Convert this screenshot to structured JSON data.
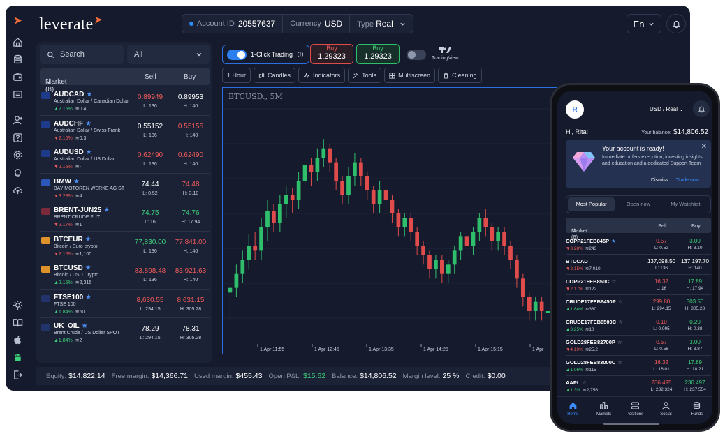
{
  "header": {
    "brand": "leverate",
    "account_id_label": "Account ID",
    "account_id": "20557637",
    "currency_label": "Currency",
    "currency": "USD",
    "type_label": "Type",
    "type": "Real",
    "language": "En"
  },
  "market_panel": {
    "search_label": "Search",
    "filter_value": "All",
    "col_market": "Market (8)",
    "col_sell": "Sell",
    "col_buy": "Buy",
    "rows": [
      {
        "symbol": "AUDCAD",
        "desc": "Australian Dollar / Canadian Dollar",
        "change": "▲2.15%",
        "vol": "≋0.4",
        "sell": "0.89949",
        "buy": "0.89953",
        "low": "L: 136",
        "high": "H: 140",
        "sell_color": "#f05a5a",
        "buy_color": "#ffffff",
        "chg_color": "#3ecf7a"
      },
      {
        "symbol": "AUDCHF",
        "desc": "Australian Dollar / Swiss Frank",
        "change": "▼2.15%",
        "vol": "≋0.3",
        "sell": "0.55152",
        "buy": "0.55155",
        "low": "L: 136",
        "high": "H: 140",
        "sell_color": "#ffffff",
        "buy_color": "#f05a5a",
        "chg_color": "#f05a5a"
      },
      {
        "symbol": "AUDUSD",
        "desc": "Australian Dollar / US Dollar",
        "change": "▼2.15%",
        "vol": "≋-",
        "sell": "0.62490",
        "buy": "0.62490",
        "low": "L: 136",
        "high": "H: 140",
        "sell_color": "#f05a5a",
        "buy_color": "#f05a5a",
        "chg_color": "#f05a5a"
      },
      {
        "symbol": "BMW",
        "desc": "BAY MOTOREN WERKE AG ST",
        "change": "▼3.28%",
        "vol": "≋4",
        "sell": "74.44",
        "buy": "74.48",
        "low": "L: 0.52",
        "high": "H: 3.10",
        "sell_color": "#ffffff",
        "buy_color": "#f05a5a",
        "chg_color": "#f05a5a"
      },
      {
        "symbol": "BRENT-JUN25",
        "desc": "BRENT CRUDE FUT",
        "change": "▼2.17%",
        "vol": "≋1",
        "sell": "74.75",
        "buy": "74.76",
        "low": "L: 16",
        "high": "H: 17.94",
        "sell_color": "#3ecf7a",
        "buy_color": "#3ecf7a",
        "chg_color": "#f05a5a"
      },
      {
        "symbol": "BTCEUR",
        "desc": "Bitcoin / Euro crypto",
        "change": "▼2.15%",
        "vol": "≋1,100",
        "sell": "77,830.00",
        "buy": "77,841.00",
        "low": "L: 136",
        "high": "H: 140",
        "sell_color": "#3ecf7a",
        "buy_color": "#f05a5a",
        "chg_color": "#f05a5a"
      },
      {
        "symbol": "BTCUSD",
        "desc": "Bitcoin / USD Crypto",
        "change": "▲2.15%",
        "vol": "≋2,315",
        "sell": "83,898.48",
        "buy": "83,921.63",
        "low": "L: 136",
        "high": "H: 140",
        "sell_color": "#f05a5a",
        "buy_color": "#f05a5a",
        "chg_color": "#3ecf7a"
      },
      {
        "symbol": "FTSE100",
        "desc": "FTSE 100",
        "change": "▲1.84%",
        "vol": "≋60",
        "sell": "8,630.55",
        "buy": "8,631.15",
        "low": "L: 294.15",
        "high": "H: 305.28",
        "sell_color": "#f05a5a",
        "buy_color": "#f05a5a",
        "chg_color": "#3ecf7a"
      },
      {
        "symbol": "UK_OIL",
        "desc": "Brent Crude / US Dollar SPOT",
        "change": "▲1.84%",
        "vol": "≋2",
        "sell": "78.29",
        "buy": "78.31",
        "low": "L: 294.15",
        "high": "H: 305.28",
        "sell_color": "#ffffff",
        "buy_color": "#ffffff",
        "chg_color": "#3ecf7a"
      }
    ]
  },
  "toolbar": {
    "one_click": "1-Click Trading",
    "buy_label": "Buy",
    "buy_left_price": "1.29323",
    "buy_right_price": "1.29323",
    "tradingview": "TradingView",
    "tools": [
      "1 Hour",
      "Candles",
      "Indicators",
      "Tools",
      "Multiscreen",
      "Cleaning"
    ]
  },
  "chart": {
    "title": "BTCUSD., 5M",
    "x_labels": [
      "1 Apr 11:55",
      "1 Apr 12:45",
      "1 Apr 13:35",
      "1 Apr 14:25",
      "1 Apr 15:15",
      "1 Apr"
    ]
  },
  "chart_data": {
    "type": "candlestick",
    "title": "BTCUSD., 5M",
    "x": [
      "1 Apr 11:55",
      "1 Apr 12:45",
      "1 Apr 13:35",
      "1 Apr 14:25",
      "1 Apr 15:15",
      "1 Apr"
    ],
    "candles": [
      [
        30,
        32,
        20,
        34,
        18
      ],
      [
        32,
        38,
        30,
        42,
        28
      ],
      [
        38,
        44,
        36,
        48,
        34
      ],
      [
        44,
        50,
        42,
        55,
        40
      ],
      [
        50,
        48,
        45,
        56,
        44
      ],
      [
        48,
        58,
        46,
        62,
        44
      ],
      [
        58,
        65,
        55,
        70,
        52
      ],
      [
        65,
        60,
        58,
        68,
        56
      ],
      [
        60,
        68,
        58,
        72,
        56
      ],
      [
        68,
        72,
        64,
        76,
        62
      ],
      [
        72,
        70,
        66,
        75,
        64
      ],
      [
        70,
        78,
        68,
        82,
        66
      ],
      [
        78,
        85,
        76,
        90,
        74
      ],
      [
        85,
        82,
        78,
        88,
        76
      ],
      [
        82,
        88,
        80,
        92,
        78
      ],
      [
        88,
        92,
        86,
        96,
        84
      ],
      [
        92,
        86,
        84,
        94,
        82
      ],
      [
        86,
        78,
        76,
        88,
        74
      ],
      [
        78,
        72,
        70,
        80,
        68
      ],
      [
        72,
        80,
        70,
        84,
        68
      ],
      [
        80,
        86,
        78,
        90,
        76
      ],
      [
        86,
        80,
        78,
        88,
        76
      ],
      [
        80,
        74,
        72,
        82,
        70
      ],
      [
        74,
        68,
        66,
        76,
        64
      ],
      [
        68,
        74,
        66,
        78,
        64
      ],
      [
        74,
        70,
        66,
        76,
        64
      ],
      [
        70,
        64,
        62,
        72,
        60
      ],
      [
        64,
        58,
        56,
        66,
        54
      ],
      [
        58,
        62,
        56,
        64,
        54
      ],
      [
        62,
        56,
        54,
        64,
        52
      ],
      [
        56,
        50,
        48,
        58,
        46
      ],
      [
        50,
        46,
        44,
        52,
        42
      ],
      [
        46,
        40,
        38,
        48,
        36
      ],
      [
        40,
        44,
        38,
        46,
        36
      ],
      [
        44,
        38,
        36,
        46,
        34
      ],
      [
        38,
        42,
        36,
        44,
        34
      ],
      [
        42,
        48,
        40,
        50,
        38
      ],
      [
        48,
        54,
        46,
        56,
        44
      ],
      [
        54,
        50,
        48,
        56,
        46
      ],
      [
        50,
        56,
        48,
        58,
        46
      ],
      [
        56,
        62,
        54,
        64,
        52
      ],
      [
        62,
        58,
        56,
        66,
        54
      ],
      [
        58,
        52,
        50,
        60,
        48
      ],
      [
        52,
        56,
        50,
        58,
        48
      ],
      [
        56,
        50,
        48,
        58,
        46
      ],
      [
        50,
        44,
        42,
        52,
        40
      ],
      [
        44,
        36,
        34,
        46,
        32
      ],
      [
        36,
        28,
        26,
        38,
        24
      ],
      [
        28,
        22,
        20,
        30,
        18
      ],
      [
        22,
        26,
        20,
        28,
        18
      ],
      [
        26,
        22,
        20,
        28,
        18
      ],
      [
        22,
        22,
        20,
        24,
        20
      ]
    ]
  },
  "status": {
    "equity_label": "Equity:",
    "equity": "$14,822.14",
    "free_margin_label": "Free margin:",
    "free_margin": "$14,366.71",
    "used_margin_label": "Used margin:",
    "used_margin": "$455.43",
    "pnl_label": "Open P&L:",
    "pnl": "$15.62",
    "balance_label": "Balance:",
    "balance": "$14,806.52",
    "margin_level_label": "Margin level:",
    "margin_level": "25 %",
    "credit_label": "Credit:",
    "credit": "$0.00"
  },
  "phone": {
    "avatar": "R",
    "account": "USD / Real",
    "greeting": "Hi, Rita!",
    "balance_label": "Your balance:",
    "balance": "$14,806.52",
    "card_title": "Your account is ready!",
    "card_body": "Immediate orders execution, investing insights and education and a dedicated Support Team",
    "dismiss": "Dismiss",
    "trade_now": "Trade now",
    "tabs": [
      "Most Popular",
      "Open now",
      "My Watchlist"
    ],
    "col_market": "Market (8)",
    "col_sell": "Sell",
    "col_buy": "Buy",
    "rows": [
      {
        "symbol": "COPP21FEB845P",
        "change": "▼3.28%",
        "vol": "≋243",
        "sell": "0.57",
        "buy": "3.00",
        "low": "L: 0.52",
        "high": "H: 3.10",
        "sell_color": "#f05a5a",
        "buy_color": "#3ecf7a",
        "chg_color": "#f05a5a",
        "star": "★",
        "star_on": true
      },
      {
        "symbol": "BTCCAD",
        "change": "▼2.15%",
        "vol": "≋7,010",
        "sell": "137,098.50",
        "buy": "137,197.70",
        "low": "L: 136",
        "high": "H: 140",
        "sell_color": "#ffffff",
        "buy_color": "#ffffff",
        "chg_color": "#f05a5a",
        "star": "",
        "star_on": false
      },
      {
        "symbol": "COPP21FEB850C",
        "change": "▼2.17%",
        "vol": "≋122",
        "sell": "16.32",
        "buy": "17.89",
        "low": "L: 16",
        "high": "H: 17.94",
        "sell_color": "#f05a5a",
        "buy_color": "#3ecf7a",
        "chg_color": "#f05a5a",
        "star": "☆",
        "star_on": false
      },
      {
        "symbol": "CRUDE17FEB6450P",
        "change": "▲1.84%",
        "vol": "≋380",
        "sell": "299.80",
        "buy": "303.50",
        "low": "L: 294.15",
        "high": "H: 305.28",
        "sell_color": "#f05a5a",
        "buy_color": "#3ecf7a",
        "chg_color": "#3ecf7a",
        "star": "☆",
        "star_on": false
      },
      {
        "symbol": "CRUDE17FEB6500C",
        "change": "▲3.25%",
        "vol": "≋10",
        "sell": "0.10",
        "buy": "0.20",
        "low": "L: 0.095",
        "high": "H: 0.38",
        "sell_color": "#f05a5a",
        "buy_color": "#3ecf7a",
        "chg_color": "#3ecf7a",
        "star": "☆",
        "star_on": false
      },
      {
        "symbol": "GOLD28FEB82700P",
        "change": "▼4.19%",
        "vol": "≋25.2",
        "sell": "0.57",
        "buy": "3.00",
        "low": "L: 0.56",
        "high": "H: 3.87",
        "sell_color": "#f05a5a",
        "buy_color": "#3ecf7a",
        "chg_color": "#f05a5a",
        "star": "☆",
        "star_on": false
      },
      {
        "symbol": "GOLD28FEB83000C",
        "change": "▲1.06%",
        "vol": "≋115",
        "sell": "16.32",
        "buy": "17.89",
        "low": "L: 16.01",
        "high": "H: 18.21",
        "sell_color": "#f05a5a",
        "buy_color": "#3ecf7a",
        "chg_color": "#3ecf7a",
        "star": "☆",
        "star_on": false
      },
      {
        "symbol": "AAPL",
        "change": "▲1.3%",
        "vol": "≋2,756",
        "sell": "236.495",
        "buy": "236.497",
        "low": "L: 232.324",
        "high": "H: 237.554",
        "sell_color": "#f05a5a",
        "buy_color": "#3ecf7a",
        "chg_color": "#3ecf7a",
        "star": "☆",
        "star_on": false
      }
    ],
    "nav": [
      "Home",
      "Markets",
      "Positions",
      "Social",
      "Funds"
    ]
  }
}
